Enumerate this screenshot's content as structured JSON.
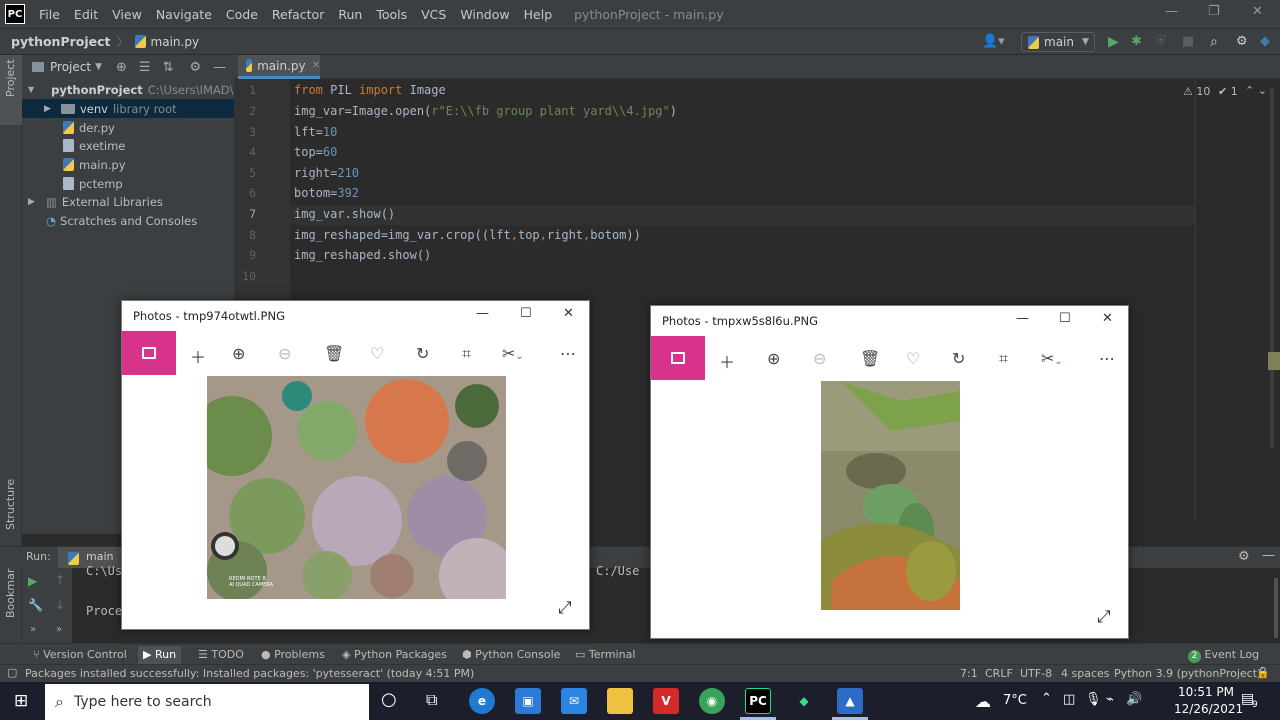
{
  "window": {
    "logo": "PC",
    "menu": [
      "File",
      "Edit",
      "View",
      "Navigate",
      "Code",
      "Refactor",
      "Run",
      "Tools",
      "VCS",
      "Window",
      "Help"
    ],
    "title": "pythonProject - main.py",
    "controls": [
      "—",
      "❐",
      "✕"
    ]
  },
  "navbar": {
    "project": "pythonProject",
    "file": "main.py",
    "run_config": "main"
  },
  "left_strip": {
    "project_label": "Project",
    "structure_label": "Structure",
    "bookmarks_label": "Bookmarks"
  },
  "project_panel": {
    "title": "Project",
    "root": {
      "name": "pythonProject",
      "path": "C:\\Users\\IMAD\\Pyc"
    },
    "venv": {
      "name": "venv",
      "note": "library root"
    },
    "files": [
      "der.py",
      "exetime",
      "main.py",
      "pctemp"
    ],
    "external": "External Libraries",
    "scratches": "Scratches and Consoles"
  },
  "editor": {
    "tab": "main.py",
    "line_numbers": [
      "1",
      "2",
      "3",
      "4",
      "5",
      "6",
      "7",
      "8",
      "9",
      "10"
    ],
    "lines": [
      [
        {
          "t": "from ",
          "c": "kw"
        },
        {
          "t": "PIL ",
          "c": ""
        },
        {
          "t": "import ",
          "c": "kw"
        },
        {
          "t": "Image",
          "c": ""
        }
      ],
      [
        {
          "t": "img_var=Image.open(",
          "c": ""
        },
        {
          "t": "r\"E:\\\\fb group plant yard\\\\4.jpg\"",
          "c": "str"
        },
        {
          "t": ")",
          "c": ""
        }
      ],
      [
        {
          "t": "lft=",
          "c": ""
        },
        {
          "t": "10",
          "c": "num"
        }
      ],
      [
        {
          "t": "top=",
          "c": ""
        },
        {
          "t": "60",
          "c": "num"
        }
      ],
      [
        {
          "t": "right=",
          "c": ""
        },
        {
          "t": "210",
          "c": "num"
        }
      ],
      [
        {
          "t": "botom=",
          "c": ""
        },
        {
          "t": "392",
          "c": "num"
        }
      ],
      [
        {
          "t": "img_var.show()",
          "c": ""
        }
      ],
      [
        {
          "t": "img_reshaped=img_var.crop((lft",
          "c": ""
        },
        {
          "t": ",",
          "c": "kw"
        },
        {
          "t": "top",
          "c": ""
        },
        {
          "t": ",",
          "c": "kw"
        },
        {
          "t": "right",
          "c": ""
        },
        {
          "t": ",",
          "c": "kw"
        },
        {
          "t": "botom))",
          "c": ""
        }
      ],
      [
        {
          "t": "img_reshaped.show()",
          "c": ""
        }
      ],
      []
    ],
    "warnings": "⚠ 10",
    "checks": "✔ 1"
  },
  "run_panel": {
    "label": "Run:",
    "config": "main",
    "output_1": "C:\\Us",
    "output_2": "Proce",
    "output_3": "C:/Use"
  },
  "tool_windows": [
    "Version Control",
    "Run",
    "TODO",
    "Problems",
    "Python Packages",
    "Python Console",
    "Terminal"
  ],
  "event_log": {
    "count": "2",
    "label": "Event Log"
  },
  "status": {
    "message": "Packages installed successfully: Installed packages: 'pytesseract' (today 4:51 PM)",
    "position": "7:1",
    "line_sep": "CRLF",
    "encoding": "UTF-8",
    "indent": "4 spaces",
    "interpreter": "Python 3.9 (pythonProject)"
  },
  "photos_left": {
    "title": "Photos - tmp974otwtl.PNG",
    "watermark": "REDMI NOTE 8\nAI QUAD CAMERA"
  },
  "photos_right": {
    "title": "Photos - tmpxw5s8l6u.PNG"
  },
  "taskbar": {
    "search_placeholder": "Type here to search",
    "weather": "7°C",
    "time": "10:51 PM",
    "date": "12/26/2021",
    "notifications": "9"
  }
}
